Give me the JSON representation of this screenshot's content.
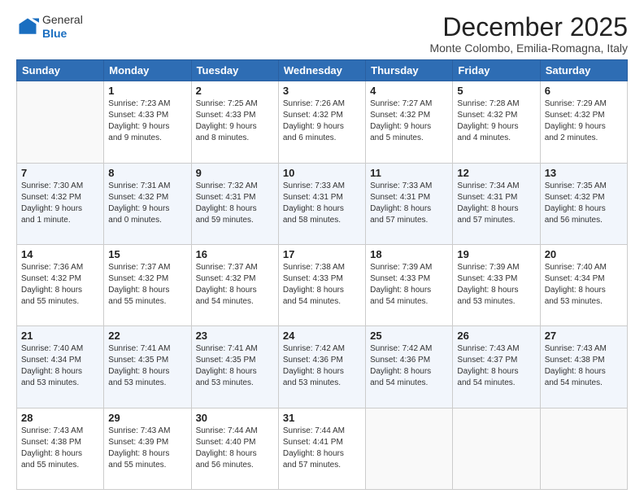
{
  "logo": {
    "line1": "General",
    "line2": "Blue"
  },
  "title": "December 2025",
  "subtitle": "Monte Colombo, Emilia-Romagna, Italy",
  "weekdays": [
    "Sunday",
    "Monday",
    "Tuesday",
    "Wednesday",
    "Thursday",
    "Friday",
    "Saturday"
  ],
  "rows": [
    [
      {
        "day": "",
        "text": ""
      },
      {
        "day": "1",
        "text": "Sunrise: 7:23 AM\nSunset: 4:33 PM\nDaylight: 9 hours\nand 9 minutes."
      },
      {
        "day": "2",
        "text": "Sunrise: 7:25 AM\nSunset: 4:33 PM\nDaylight: 9 hours\nand 8 minutes."
      },
      {
        "day": "3",
        "text": "Sunrise: 7:26 AM\nSunset: 4:32 PM\nDaylight: 9 hours\nand 6 minutes."
      },
      {
        "day": "4",
        "text": "Sunrise: 7:27 AM\nSunset: 4:32 PM\nDaylight: 9 hours\nand 5 minutes."
      },
      {
        "day": "5",
        "text": "Sunrise: 7:28 AM\nSunset: 4:32 PM\nDaylight: 9 hours\nand 4 minutes."
      },
      {
        "day": "6",
        "text": "Sunrise: 7:29 AM\nSunset: 4:32 PM\nDaylight: 9 hours\nand 2 minutes."
      }
    ],
    [
      {
        "day": "7",
        "text": "Sunrise: 7:30 AM\nSunset: 4:32 PM\nDaylight: 9 hours\nand 1 minute."
      },
      {
        "day": "8",
        "text": "Sunrise: 7:31 AM\nSunset: 4:32 PM\nDaylight: 9 hours\nand 0 minutes."
      },
      {
        "day": "9",
        "text": "Sunrise: 7:32 AM\nSunset: 4:31 PM\nDaylight: 8 hours\nand 59 minutes."
      },
      {
        "day": "10",
        "text": "Sunrise: 7:33 AM\nSunset: 4:31 PM\nDaylight: 8 hours\nand 58 minutes."
      },
      {
        "day": "11",
        "text": "Sunrise: 7:33 AM\nSunset: 4:31 PM\nDaylight: 8 hours\nand 57 minutes."
      },
      {
        "day": "12",
        "text": "Sunrise: 7:34 AM\nSunset: 4:31 PM\nDaylight: 8 hours\nand 57 minutes."
      },
      {
        "day": "13",
        "text": "Sunrise: 7:35 AM\nSunset: 4:32 PM\nDaylight: 8 hours\nand 56 minutes."
      }
    ],
    [
      {
        "day": "14",
        "text": "Sunrise: 7:36 AM\nSunset: 4:32 PM\nDaylight: 8 hours\nand 55 minutes."
      },
      {
        "day": "15",
        "text": "Sunrise: 7:37 AM\nSunset: 4:32 PM\nDaylight: 8 hours\nand 55 minutes."
      },
      {
        "day": "16",
        "text": "Sunrise: 7:37 AM\nSunset: 4:32 PM\nDaylight: 8 hours\nand 54 minutes."
      },
      {
        "day": "17",
        "text": "Sunrise: 7:38 AM\nSunset: 4:33 PM\nDaylight: 8 hours\nand 54 minutes."
      },
      {
        "day": "18",
        "text": "Sunrise: 7:39 AM\nSunset: 4:33 PM\nDaylight: 8 hours\nand 54 minutes."
      },
      {
        "day": "19",
        "text": "Sunrise: 7:39 AM\nSunset: 4:33 PM\nDaylight: 8 hours\nand 53 minutes."
      },
      {
        "day": "20",
        "text": "Sunrise: 7:40 AM\nSunset: 4:34 PM\nDaylight: 8 hours\nand 53 minutes."
      }
    ],
    [
      {
        "day": "21",
        "text": "Sunrise: 7:40 AM\nSunset: 4:34 PM\nDaylight: 8 hours\nand 53 minutes."
      },
      {
        "day": "22",
        "text": "Sunrise: 7:41 AM\nSunset: 4:35 PM\nDaylight: 8 hours\nand 53 minutes."
      },
      {
        "day": "23",
        "text": "Sunrise: 7:41 AM\nSunset: 4:35 PM\nDaylight: 8 hours\nand 53 minutes."
      },
      {
        "day": "24",
        "text": "Sunrise: 7:42 AM\nSunset: 4:36 PM\nDaylight: 8 hours\nand 53 minutes."
      },
      {
        "day": "25",
        "text": "Sunrise: 7:42 AM\nSunset: 4:36 PM\nDaylight: 8 hours\nand 54 minutes."
      },
      {
        "day": "26",
        "text": "Sunrise: 7:43 AM\nSunset: 4:37 PM\nDaylight: 8 hours\nand 54 minutes."
      },
      {
        "day": "27",
        "text": "Sunrise: 7:43 AM\nSunset: 4:38 PM\nDaylight: 8 hours\nand 54 minutes."
      }
    ],
    [
      {
        "day": "28",
        "text": "Sunrise: 7:43 AM\nSunset: 4:38 PM\nDaylight: 8 hours\nand 55 minutes."
      },
      {
        "day": "29",
        "text": "Sunrise: 7:43 AM\nSunset: 4:39 PM\nDaylight: 8 hours\nand 55 minutes."
      },
      {
        "day": "30",
        "text": "Sunrise: 7:44 AM\nSunset: 4:40 PM\nDaylight: 8 hours\nand 56 minutes."
      },
      {
        "day": "31",
        "text": "Sunrise: 7:44 AM\nSunset: 4:41 PM\nDaylight: 8 hours\nand 57 minutes."
      },
      {
        "day": "",
        "text": ""
      },
      {
        "day": "",
        "text": ""
      },
      {
        "day": "",
        "text": ""
      }
    ]
  ]
}
